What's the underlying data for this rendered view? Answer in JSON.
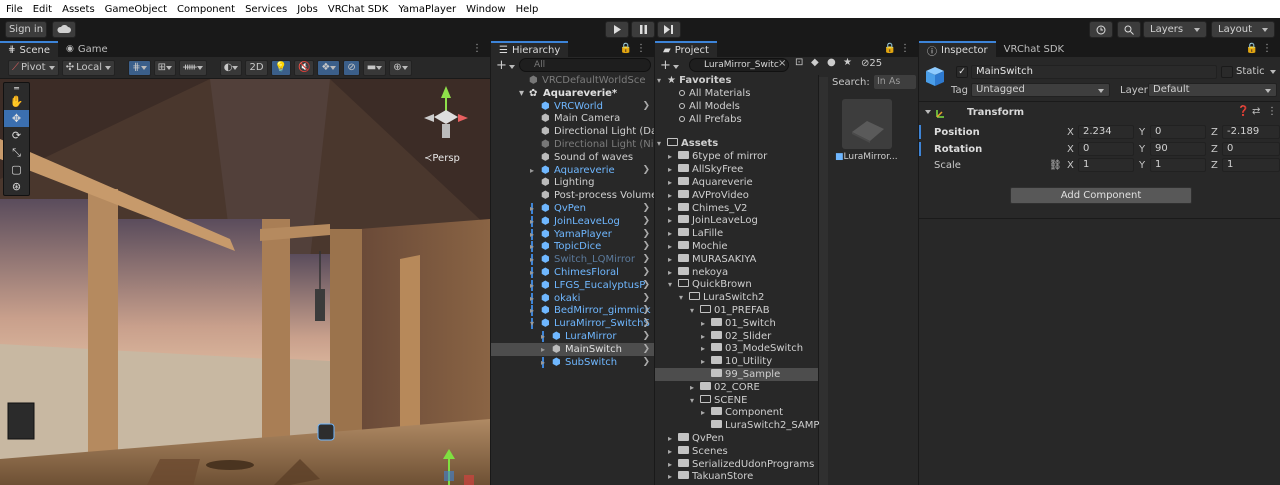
{
  "menu": [
    "File",
    "Edit",
    "Assets",
    "GameObject",
    "Component",
    "Services",
    "Jobs",
    "VRChat SDK",
    "YamaPlayer",
    "Window",
    "Help"
  ],
  "toolbar": {
    "signin": "Sign in",
    "layers": "Layers",
    "layout": "Layout"
  },
  "scene": {
    "tab_scene": "Scene",
    "tab_game": "Game",
    "pivot": "Pivot",
    "local": "Local",
    "mode2d": "2D",
    "persp": "≺Persp"
  },
  "hierarchy": {
    "tab": "Hierarchy",
    "search_placeholder": "All",
    "rows": [
      {
        "label": "VRCDefaultWorldSce",
        "indent": 1,
        "style": "dim"
      },
      {
        "label": "Aquareverie*",
        "indent": 0,
        "style": "bold"
      },
      {
        "label": "VRCWorld",
        "indent": 2,
        "style": "prefab"
      },
      {
        "label": "Main Camera",
        "indent": 2,
        "style": "normal"
      },
      {
        "label": "Directional Light (Day",
        "indent": 2,
        "style": "normal"
      },
      {
        "label": "Directional Light (Nigh",
        "indent": 2,
        "style": "dim"
      },
      {
        "label": "Sound of waves",
        "indent": 2,
        "style": "normal"
      },
      {
        "label": "Aquareverie",
        "indent": 2,
        "style": "prefab"
      },
      {
        "label": "Lighting",
        "indent": 2,
        "style": "normal"
      },
      {
        "label": "Post-process Volume",
        "indent": 2,
        "style": "normal"
      },
      {
        "label": "QvPen",
        "indent": 2,
        "style": "prefab"
      },
      {
        "label": "JoinLeaveLog",
        "indent": 2,
        "style": "prefab"
      },
      {
        "label": "YamaPlayer",
        "indent": 2,
        "style": "prefab"
      },
      {
        "label": "TopicDice",
        "indent": 2,
        "style": "prefab"
      },
      {
        "label": "Switch_LQMirror",
        "indent": 2,
        "style": "prefab-dim"
      },
      {
        "label": "ChimesFloral",
        "indent": 2,
        "style": "prefab"
      },
      {
        "label": "LFGS_EucalyptusP",
        "indent": 2,
        "style": "prefab"
      },
      {
        "label": "okaki",
        "indent": 2,
        "style": "prefab"
      },
      {
        "label": "BedMirror_gimmick",
        "indent": 2,
        "style": "prefab"
      },
      {
        "label": "LuraMirror_SwitchS",
        "indent": 2,
        "style": "prefab"
      },
      {
        "label": "LuraMirror",
        "indent": 3,
        "style": "prefab"
      },
      {
        "label": "MainSwitch",
        "indent": 3,
        "style": "selected"
      },
      {
        "label": "SubSwitch",
        "indent": 3,
        "style": "prefab"
      }
    ]
  },
  "project": {
    "tab": "Project",
    "search_value": "LuraMirror_Switc",
    "search_in_label": "Search:",
    "search_in_value": "In As",
    "hidden_count": "25",
    "favorites_label": "Favorites",
    "favorites": [
      "All Materials",
      "All Models",
      "All Prefabs"
    ],
    "assets_label": "Assets",
    "tree": [
      {
        "label": "6type of mirror",
        "level": 1
      },
      {
        "label": "AllSkyFree",
        "level": 1
      },
      {
        "label": "Aquareverie",
        "level": 1
      },
      {
        "label": "AVProVideo",
        "level": 1
      },
      {
        "label": "Chimes_V2",
        "level": 1
      },
      {
        "label": "JoinLeaveLog",
        "level": 1
      },
      {
        "label": "LaFille",
        "level": 1
      },
      {
        "label": "Mochie",
        "level": 1
      },
      {
        "label": "MURASAKIYA",
        "level": 1
      },
      {
        "label": "nekoya",
        "level": 1
      },
      {
        "label": "QuickBrown",
        "level": 1,
        "open": true
      },
      {
        "label": "LuraSwitch2",
        "level": 2,
        "open": true
      },
      {
        "label": "01_PREFAB",
        "level": 3,
        "open": true
      },
      {
        "label": "01_Switch",
        "level": 4
      },
      {
        "label": "02_Slider",
        "level": 4
      },
      {
        "label": "03_ModeSwitch",
        "level": 4
      },
      {
        "label": "10_Utility",
        "level": 4
      },
      {
        "label": "99_Sample",
        "level": 4,
        "selected": true,
        "noarrow": true
      },
      {
        "label": "02_CORE",
        "level": 3
      },
      {
        "label": "SCENE",
        "level": 3,
        "open": true
      },
      {
        "label": "Component",
        "level": 4
      },
      {
        "label": "LuraSwitch2_SAMP",
        "level": 4,
        "noarrow": true
      },
      {
        "label": "QvPen",
        "level": 1
      },
      {
        "label": "Scenes",
        "level": 1
      },
      {
        "label": "SerializedUdonPrograms",
        "level": 1
      },
      {
        "label": "TakuanStore",
        "level": 1
      }
    ],
    "result_label": "LuraMirror..."
  },
  "inspector": {
    "tab_inspector": "Inspector",
    "tab_sdk": "VRChat SDK",
    "object_name": "MainSwitch",
    "static_label": "Static",
    "tag_label": "Tag",
    "tag_value": "Untagged",
    "layer_label": "Layer",
    "layer_value": "Default",
    "transform_label": "Transform",
    "position": {
      "label": "Position",
      "x": "2.234",
      "y": "0",
      "z": "-2.189"
    },
    "rotation": {
      "label": "Rotation",
      "x": "0",
      "y": "90",
      "z": "0"
    },
    "scale": {
      "label": "Scale",
      "x": "1",
      "y": "1",
      "z": "1"
    },
    "axis": {
      "x": "X",
      "y": "Y",
      "z": "Z"
    },
    "add_component": "Add Component"
  },
  "colors": {
    "accent": "#3d84d8",
    "prefab": "#6fb7ff",
    "selection": "#4d4d4d"
  }
}
